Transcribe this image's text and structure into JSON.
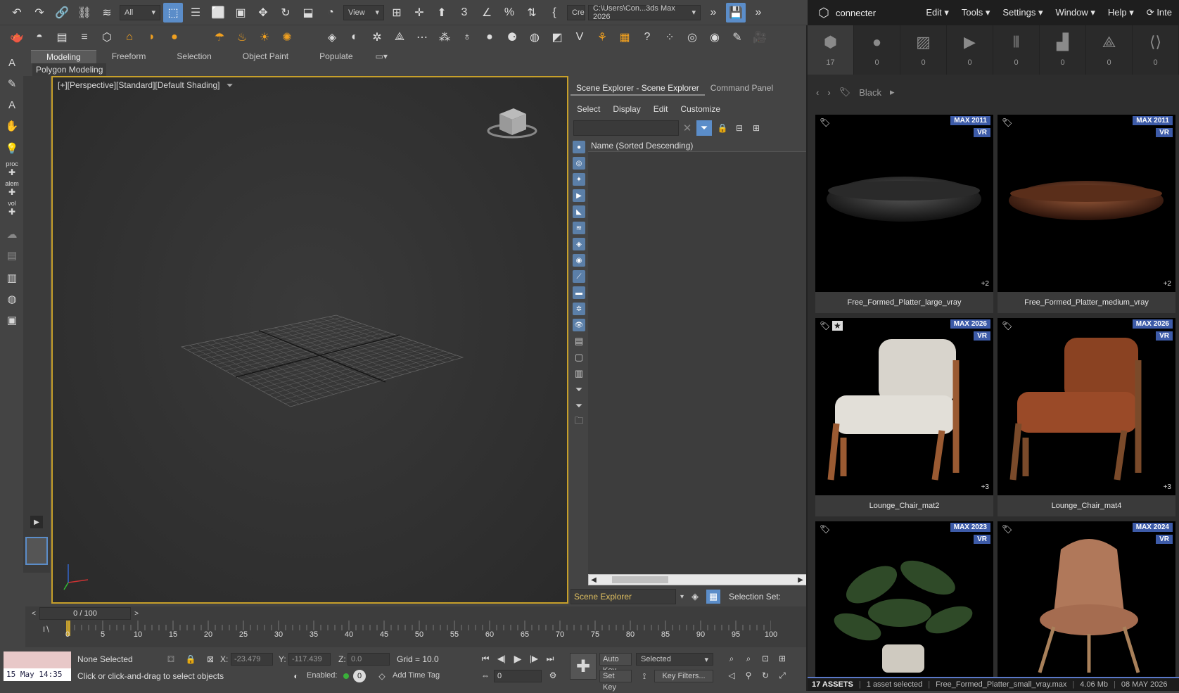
{
  "toolbar": {
    "selection_filter": "All",
    "reference_coord": "View",
    "create_sel_set": "Cre",
    "project_path": "C:\\Users\\Con...3ds Max 2026"
  },
  "ribbon": {
    "tabs": [
      "Modeling",
      "Freeform",
      "Selection",
      "Object Paint",
      "Populate"
    ],
    "active_tab": "Modeling",
    "panel_label": "Polygon Modeling"
  },
  "left_strip": {
    "labels": [
      "proc",
      "alem",
      "vol"
    ]
  },
  "viewport": {
    "label": "[+][Perspective][Standard][Default Shading]"
  },
  "scene_explorer": {
    "tabs": [
      "Scene Explorer - Scene Explorer",
      "Command Panel"
    ],
    "menu": [
      "Select",
      "Display",
      "Edit",
      "Customize"
    ],
    "column_header": "Name (Sorted Descending)",
    "explorer_name": "Scene Explorer",
    "selection_set_label": "Selection Set:"
  },
  "timeline": {
    "frame_display": "0 / 100",
    "ticks": [
      "0",
      "5",
      "10",
      "15",
      "20",
      "25",
      "30",
      "35",
      "40",
      "45",
      "50",
      "55",
      "60",
      "65",
      "70",
      "75",
      "80",
      "85",
      "90",
      "95",
      "100"
    ]
  },
  "status": {
    "clock": "15 May 14:35",
    "selection": "None Selected",
    "hint": "Click or click-and-drag to select objects",
    "x_label": "X:",
    "x_value": "-23.479",
    "y_label": "Y:",
    "y_value": "-117.439",
    "z_label": "Z:",
    "z_value": "0.0",
    "grid": "Grid = 10.0",
    "enabled_label": "Enabled:",
    "time_tag": "Add Time Tag",
    "auto_key": "Auto Key",
    "set_key": "Set Key",
    "key_mode": "Selected",
    "key_filters": "Key Filters...",
    "current_frame": "0"
  },
  "connecter": {
    "brand": "connecter",
    "menu": [
      "Edit",
      "Tools",
      "Settings",
      "Window",
      "Help"
    ],
    "extra": "Inte",
    "categories": [
      {
        "icon": "cube",
        "count": "17"
      },
      {
        "icon": "sphere",
        "count": "0"
      },
      {
        "icon": "image",
        "count": "0"
      },
      {
        "icon": "film",
        "count": "0"
      },
      {
        "icon": "audio",
        "count": "0"
      },
      {
        "icon": "building",
        "count": "0"
      },
      {
        "icon": "compass",
        "count": "0"
      },
      {
        "icon": "code",
        "count": "0"
      }
    ],
    "breadcrumb": "Black",
    "assets": [
      {
        "name": "Free_Formed_Platter_large_vray",
        "version": "MAX 2011",
        "renderer": "VR",
        "extra": "+2"
      },
      {
        "name": "Free_Formed_Platter_medium_vray",
        "version": "MAX 2011",
        "renderer": "VR",
        "extra": "+2"
      },
      {
        "name": "Lounge_Chair_mat2",
        "version": "MAX 2026",
        "renderer": "VR",
        "extra": "+3"
      },
      {
        "name": "Lounge_Chair_mat4",
        "version": "MAX 2026",
        "renderer": "VR",
        "extra": "+3"
      },
      {
        "name": "",
        "version": "MAX 2023",
        "renderer": "VR",
        "extra": ""
      },
      {
        "name": "",
        "version": "MAX 2024",
        "renderer": "VR",
        "extra": ""
      }
    ],
    "status": {
      "assets": "17 ASSETS",
      "selected": "1 asset selected",
      "file": "Free_Formed_Platter_small_vray.max",
      "size": "4.06 Mb",
      "date": "08 MAY 2026"
    }
  },
  "colors": {
    "viewport_border": "#c7a02a",
    "badge_blue": "#3d5ba8",
    "active_blue": "#5b8dc9"
  }
}
